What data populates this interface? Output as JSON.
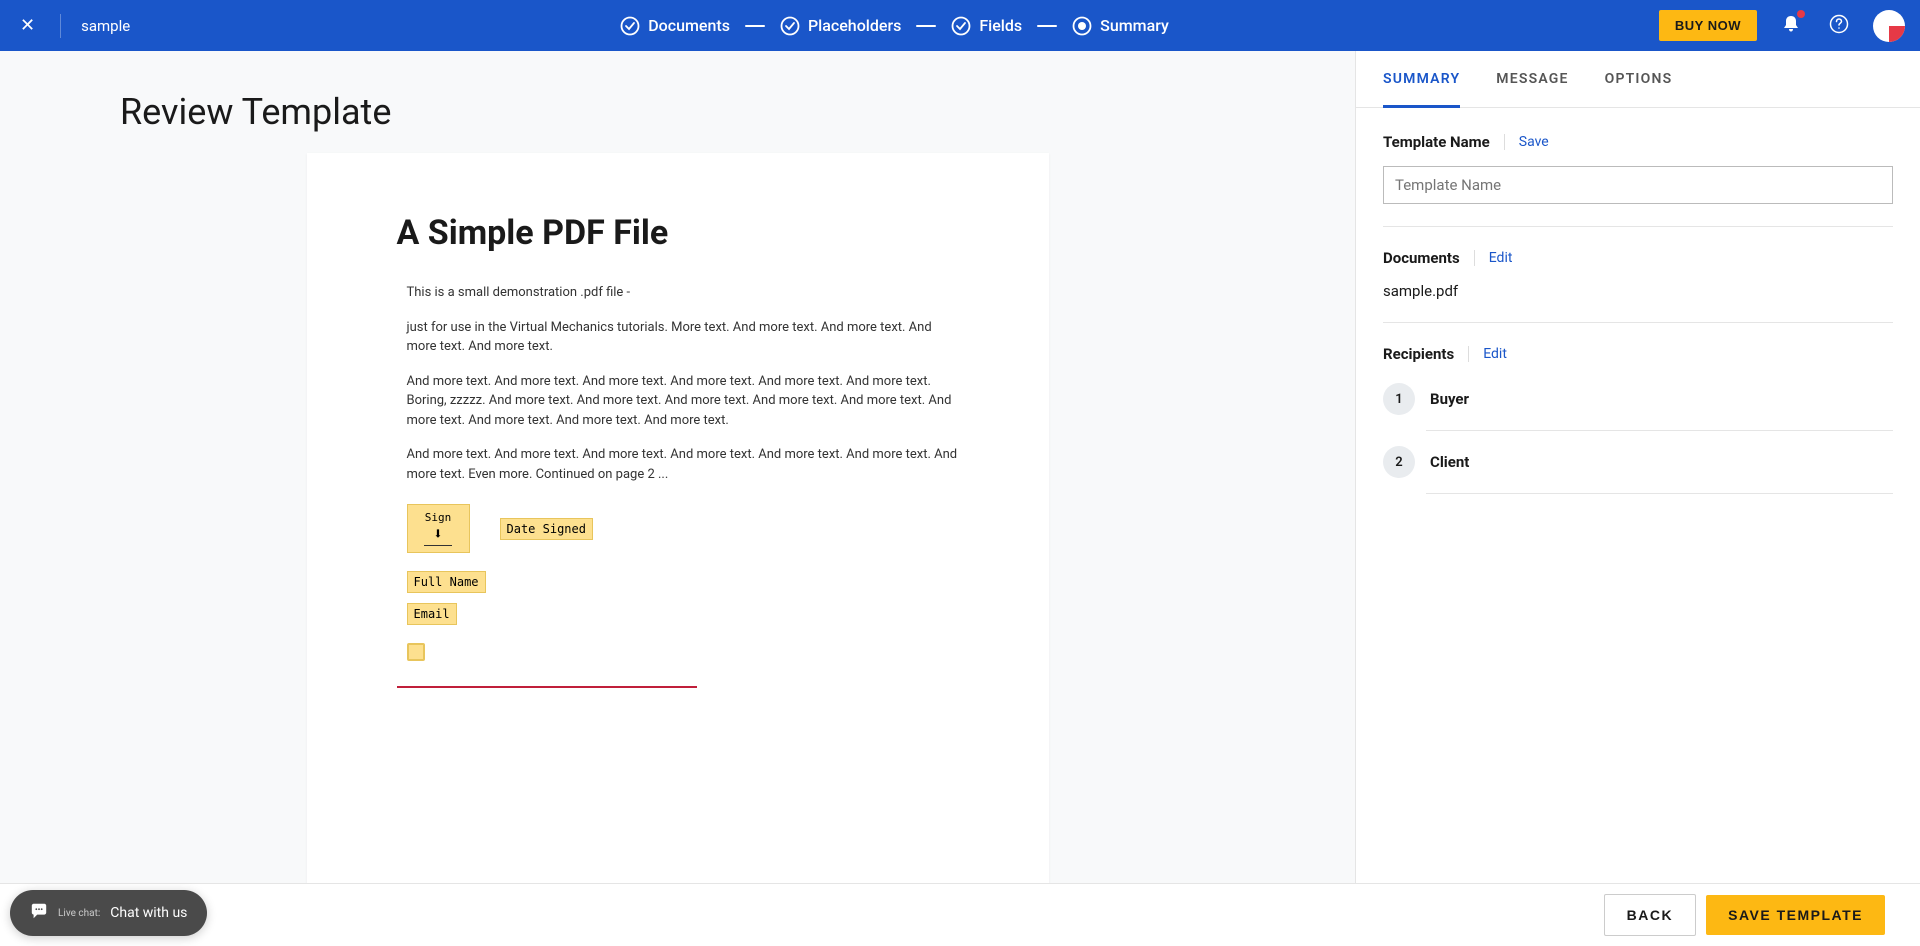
{
  "header": {
    "doc_title": "sample",
    "steps": [
      {
        "label": "Documents",
        "done": true
      },
      {
        "label": "Placeholders",
        "done": true
      },
      {
        "label": "Fields",
        "done": true
      },
      {
        "label": "Summary",
        "done": false,
        "active": true
      }
    ],
    "buy_label": "BUY NOW"
  },
  "page_title": "Review Template",
  "pdf": {
    "title": "A Simple PDF File",
    "p1": "This is a small demonstration .pdf file -",
    "p2": "just for use in the Virtual Mechanics tutorials. More text. And more text. And more text. And more text. And more text.",
    "p3": "And more text. And more text. And more text. And more text. And more text. And more text. Boring, zzzzz. And more text. And more text. And more text. And more text. And more text. And more text. And more text. And more text. And more text.",
    "p4": "And more text. And more text. And more text. And more text. And more text. And more text. And more text. Even more. Continued on page 2 ...",
    "fields": {
      "sign": "Sign",
      "date": "Date Signed",
      "name": "Full Name",
      "email": "Email"
    }
  },
  "panel": {
    "tabs": [
      "SUMMARY",
      "MESSAGE",
      "OPTIONS"
    ],
    "active_tab": 0,
    "template_name": {
      "title": "Template Name",
      "action": "Save",
      "placeholder": "Template Name",
      "value": ""
    },
    "documents": {
      "title": "Documents",
      "action": "Edit",
      "files": [
        "sample.pdf"
      ]
    },
    "recipients": {
      "title": "Recipients",
      "action": "Edit",
      "list": [
        {
          "num": "1",
          "name": "Buyer"
        },
        {
          "num": "2",
          "name": "Client"
        }
      ]
    }
  },
  "footer": {
    "back": "BACK",
    "save": "SAVE TEMPLATE"
  },
  "chat": {
    "prefix": "Live chat:",
    "label": "Chat with us"
  }
}
